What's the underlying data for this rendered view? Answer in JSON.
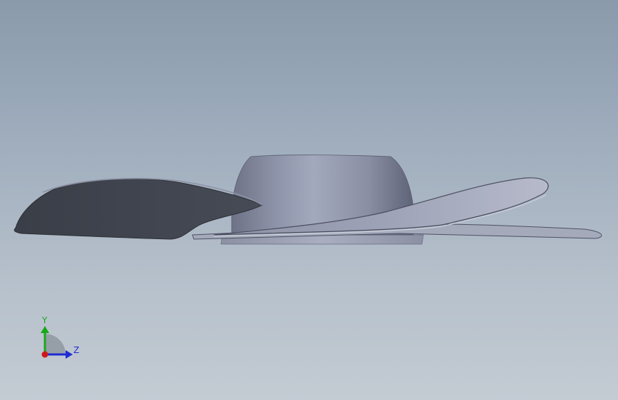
{
  "viewport": {
    "background_top": "#8a9aab",
    "background_bottom": "#c3cbd3"
  },
  "model": {
    "description_icon": "fan-blade-model",
    "blade_color": "#9aa0b2",
    "blade_shadow_color": "#40444e",
    "hub_color": "#8c91a6"
  },
  "triad": {
    "y_label": "Y",
    "z_label": "Z",
    "y_color": "#19a819",
    "z_color": "#1f2ad6",
    "x_color": "#d01818"
  }
}
